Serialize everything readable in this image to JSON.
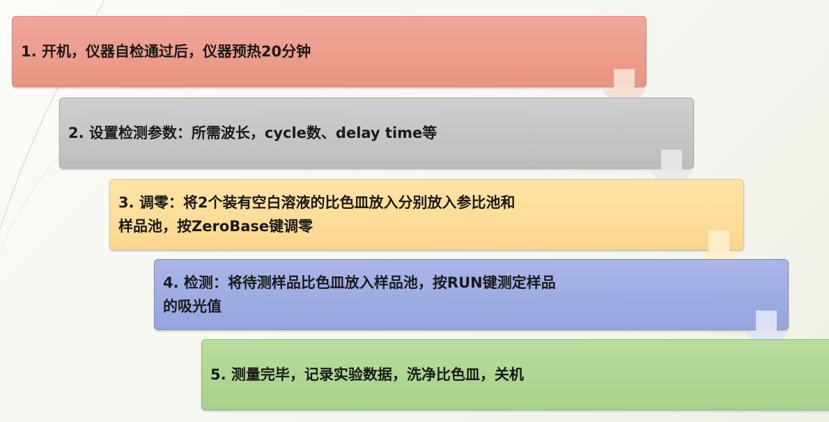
{
  "steps": [
    {
      "text": "1. 开机，仪器自检通过后，仪器预热20分钟",
      "color": "#f2a79a"
    },
    {
      "text": "2. 设置检测参数：所需波长，cycle数、delay time等",
      "color": "#cfcfcf"
    },
    {
      "text": "3. 调零：将2个装有空白溶液的比色皿放入分别放入参比池和\n样品池，按ZeroBase键调零",
      "color": "#ffe4a6"
    },
    {
      "text": "4. 检测：将待测样品比色皿放入样品池，按RUN键测定样品\n的吸光值",
      "color": "#a9b5e8"
    },
    {
      "text": "5. 测量完毕，记录实验数据，洗净比色皿，关机",
      "color": "#b8dc9c"
    }
  ],
  "connector": {
    "icon": "down-arrow-icon",
    "color": "#f4d3c8"
  }
}
